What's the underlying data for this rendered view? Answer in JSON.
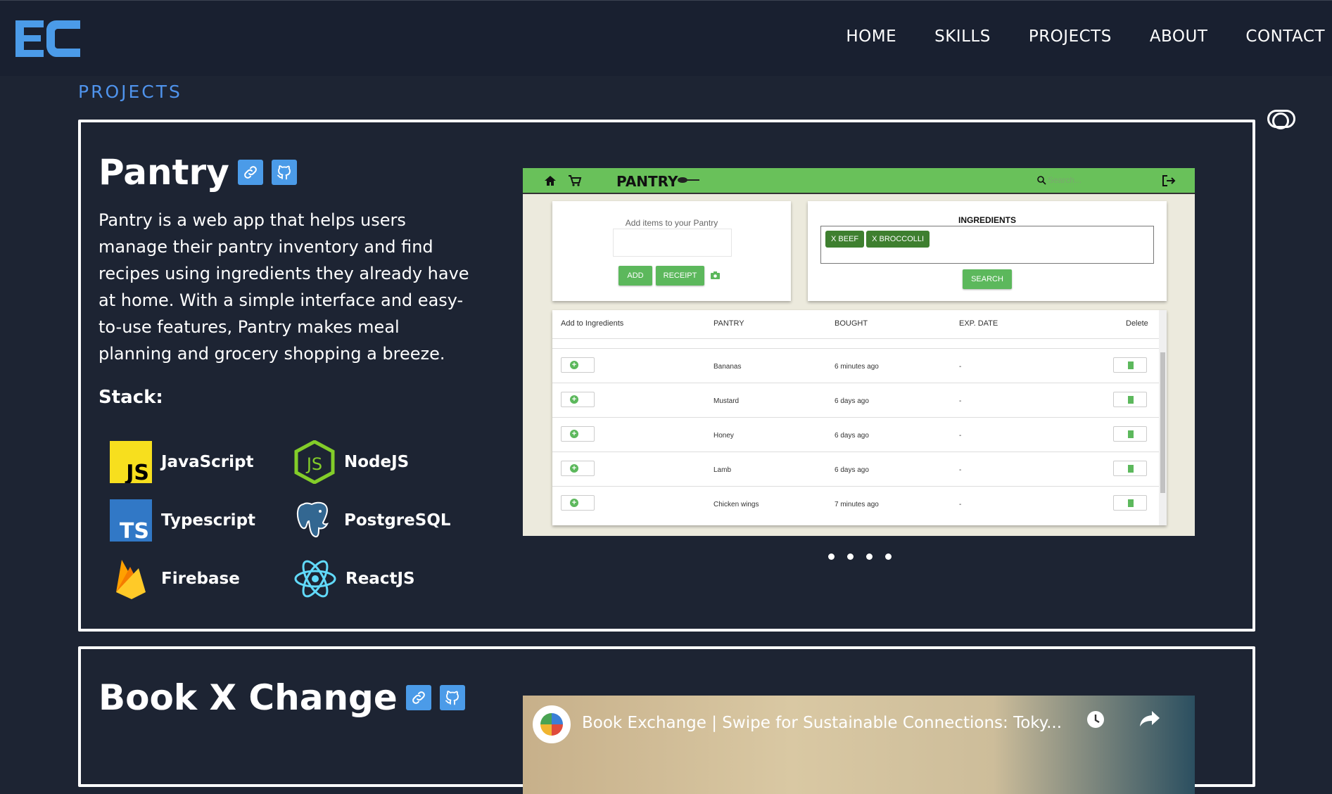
{
  "navbar": {
    "logo_text": "EC",
    "items": [
      {
        "label": "HOME"
      },
      {
        "label": "SKILLS"
      },
      {
        "label": "PROJECTS"
      },
      {
        "label": "ABOUT"
      },
      {
        "label": "CONTACT"
      }
    ]
  },
  "section_label": "PROJECTS",
  "colors": {
    "accent": "#4f93ec",
    "background": "#1d2433",
    "navbar": "#192030",
    "pantry_green": "#69c15a"
  },
  "projects": [
    {
      "title": "Pantry",
      "description": "Pantry is a web app that helps users manage their pantry inventory and find recipes using ingredients they already have at home. With a simple interface and easy-to-use features, Pantry makes meal planning and grocery shopping a breeze.",
      "stack_label": "Stack:",
      "stack": [
        {
          "name": "JavaScript",
          "icon": "javascript-icon"
        },
        {
          "name": "NodeJS",
          "icon": "nodejs-icon"
        },
        {
          "name": "Typescript",
          "icon": "typescript-icon"
        },
        {
          "name": "PostgreSQL",
          "icon": "postgresql-icon"
        },
        {
          "name": "Firebase",
          "icon": "firebase-icon"
        },
        {
          "name": "ReactJS",
          "icon": "react-icon"
        }
      ],
      "carousel_slides": 4,
      "screenshot": {
        "app_title": "PANTRY",
        "search_placeholder": "Search...",
        "add_label": "Add items to your Pantry",
        "add_button": "ADD",
        "receipt_button": "RECEIPT",
        "ingredients_title": "INGREDIENTS",
        "chips": [
          "X BEEF",
          "X BROCCOLLI"
        ],
        "search_button": "SEARCH",
        "columns": [
          "Add to Ingredients",
          "PANTRY",
          "BOUGHT",
          "EXP. DATE",
          "Delete"
        ],
        "rows": [
          {
            "item": "Bananas",
            "bought": "6 minutes ago",
            "exp": "-"
          },
          {
            "item": "Mustard",
            "bought": "6 days ago",
            "exp": "-"
          },
          {
            "item": "Honey",
            "bought": "6 days ago",
            "exp": "-"
          },
          {
            "item": "Lamb",
            "bought": "6 days ago",
            "exp": "-"
          },
          {
            "item": "Chicken wings",
            "bought": "7 minutes ago",
            "exp": "-"
          }
        ]
      }
    },
    {
      "title": "Book X Change",
      "video_title": "Book Exchange | Swipe for Sustainable Connections: Toky..."
    }
  ]
}
